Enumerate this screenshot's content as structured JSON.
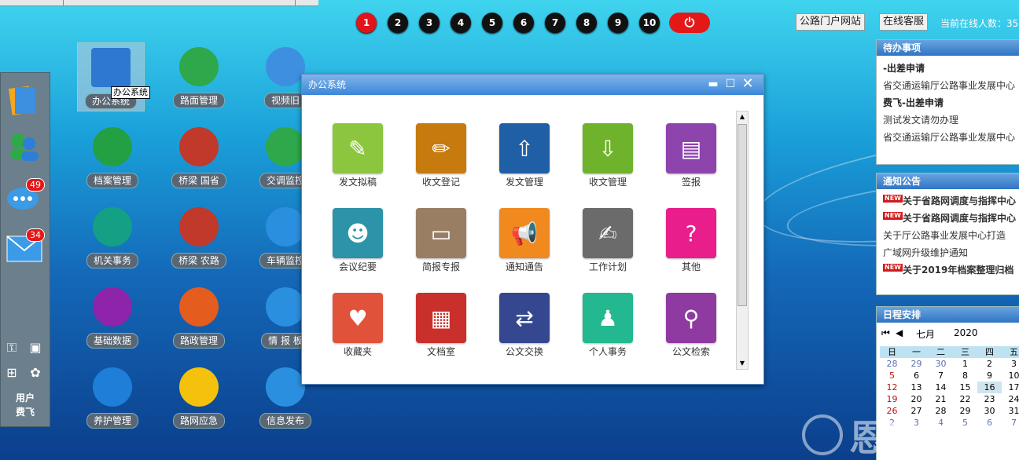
{
  "pages": [
    "1",
    "2",
    "3",
    "4",
    "5",
    "6",
    "7",
    "8",
    "9",
    "10"
  ],
  "active_page": "1",
  "power_icon": "power-icon",
  "header": {
    "portal_button": "公路门户网站",
    "service_button": "在线客服",
    "online_label": "当前在线人数：35"
  },
  "sidebar": {
    "badges": {
      "chat": "49",
      "mail": "34"
    },
    "user_label": "用户",
    "user_name": "费飞"
  },
  "desktop": {
    "icons": [
      {
        "label": "办公系统",
        "color": "#2e78d2",
        "icon": "office-icon"
      },
      {
        "label": "路面管理",
        "color": "#2ea84a",
        "icon": "road-icon"
      },
      {
        "label": "视频旧",
        "color": "#3f8fe0",
        "icon": "camera-icon"
      },
      {
        "label": "档案管理",
        "color": "#23a043",
        "icon": "archive-chart-icon"
      },
      {
        "label": "桥梁 国省",
        "color": "#c0392b",
        "icon": "bridge-icon"
      },
      {
        "label": "交调监控",
        "color": "#2ea84a",
        "icon": "traffic-chart-icon"
      },
      {
        "label": "机关事务",
        "color": "#13a085",
        "icon": "printer-icon"
      },
      {
        "label": "桥梁 农路",
        "color": "#c0392b",
        "icon": "bridge-icon"
      },
      {
        "label": "车辆监控",
        "color": "#2b8fe0",
        "icon": "location-icon"
      },
      {
        "label": "基础数据",
        "color": "#8e24aa",
        "icon": "database-icon"
      },
      {
        "label": "路政管理",
        "color": "#e45c1e",
        "icon": "emblem-icon"
      },
      {
        "label": "情 报 板",
        "color": "#2b8fe0",
        "icon": "led-board-icon"
      },
      {
        "label": "养护管理",
        "color": "#1f7fd8",
        "icon": "maintenance-icon"
      },
      {
        "label": "路网应急",
        "color": "#f4c20d",
        "icon": "warning-icon"
      },
      {
        "label": "信息发布",
        "color": "#2b8fe0",
        "icon": "twitter-icon"
      }
    ],
    "tooltip": "办公系统"
  },
  "window": {
    "title": "办公系统",
    "apps": [
      {
        "label": "发文拟稿",
        "color": "#8cc63f",
        "icon": "draft-icon"
      },
      {
        "label": "收文登记",
        "color": "#c77a0e",
        "icon": "pen-icon"
      },
      {
        "label": "发文管理",
        "color": "#1f5fa5",
        "icon": "upload-icon"
      },
      {
        "label": "收文管理",
        "color": "#6fb22b",
        "icon": "download-icon"
      },
      {
        "label": "签报",
        "color": "#8e44ad",
        "icon": "clipboard-icon"
      },
      {
        "label": "会议纪要",
        "color": "#2c93a8",
        "icon": "meeting-icon"
      },
      {
        "label": "简报专报",
        "color": "#9a7e64",
        "icon": "newspaper-icon"
      },
      {
        "label": "通知通告",
        "color": "#f0891e",
        "icon": "megaphone-icon"
      },
      {
        "label": "工作计划",
        "color": "#6b6b6b",
        "icon": "edit-icon"
      },
      {
        "label": "其他",
        "color": "#e91e8c",
        "icon": "monitor-question-icon"
      },
      {
        "label": "收藏夹",
        "color": "#e0533a",
        "icon": "heart-folder-icon"
      },
      {
        "label": "文档室",
        "color": "#c9302c",
        "icon": "document-folder-icon"
      },
      {
        "label": "公文交换",
        "color": "#34478f",
        "icon": "exchange-icon"
      },
      {
        "label": "个人事务",
        "color": "#23b88f",
        "icon": "person-icon"
      },
      {
        "label": "公文检索",
        "color": "#8e3aa0",
        "icon": "search-icon"
      }
    ]
  },
  "todo": {
    "title": "待办事项",
    "items": [
      {
        "text": "-出差申请",
        "bold": true
      },
      {
        "text": "省交通运输厅公路事业发展中心",
        "bold": false
      },
      {
        "text": "费飞-出差申请",
        "bold": true
      },
      {
        "text": "测试发文请勿办理",
        "bold": false
      },
      {
        "text": "省交通运输厅公路事业发展中心",
        "bold": false
      }
    ]
  },
  "notices": {
    "title": "通知公告",
    "new_badge": "NEW",
    "items": [
      {
        "text": "关于省路网调度与指挥中心",
        "new": true
      },
      {
        "text": "关于省路网调度与指挥中心",
        "new": true
      },
      {
        "text": "关于厅公路事业发展中心打造",
        "new": false
      },
      {
        "text": "广域网升级维护通知",
        "new": false
      },
      {
        "text": "关于2019年档案整理归档",
        "new": true
      }
    ]
  },
  "calendar": {
    "title": "日程安排",
    "month": "七月",
    "year": "2020",
    "weekdays": [
      "日",
      "一",
      "二",
      "三",
      "四",
      "五"
    ],
    "rows": [
      [
        "28",
        "29",
        "30",
        "1",
        "2",
        "3"
      ],
      [
        "5",
        "6",
        "7",
        "8",
        "9",
        "10"
      ],
      [
        "12",
        "13",
        "14",
        "15",
        "16",
        "17"
      ],
      [
        "19",
        "20",
        "21",
        "22",
        "23",
        "24"
      ],
      [
        "26",
        "27",
        "28",
        "29",
        "30",
        "31"
      ],
      [
        "2",
        "3",
        "4",
        "5",
        "6",
        "7"
      ]
    ],
    "today": "16"
  },
  "watermark": "恩动科技"
}
